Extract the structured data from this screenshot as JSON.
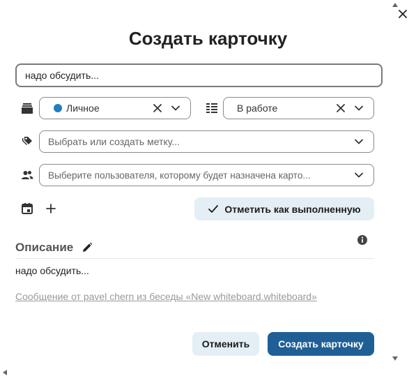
{
  "dialog": {
    "title": "Создать карточку",
    "close_icon": "close-icon"
  },
  "card_title": {
    "value": "надо обсудить..."
  },
  "board_select": {
    "icon": "stack-icon",
    "value": "Личное",
    "dot_color": "#1f7fbf"
  },
  "stack_select": {
    "icon": "list-columns-icon",
    "value": "В работе"
  },
  "labels_select": {
    "icon": "tag-icon",
    "placeholder": "Выбрать или создать метку..."
  },
  "assignee_select": {
    "icon": "users-icon",
    "placeholder": "Выберите пользователя, которому будет назначена карто..."
  },
  "actions_row": {
    "calendar_icon": "calendar-icon",
    "add_icon": "plus-icon",
    "complete_label": "Отметить как выполненную"
  },
  "description": {
    "heading": "Описание",
    "text": "надо обсудить...",
    "link_text": "Сообщение от pavel chern из беседы «New whiteboard.whiteboard»"
  },
  "footer": {
    "cancel_label": "Отменить",
    "create_label": "Создать карточку"
  },
  "colors": {
    "primary": "#1f5f96",
    "secondary_bg": "#e4eef5"
  }
}
